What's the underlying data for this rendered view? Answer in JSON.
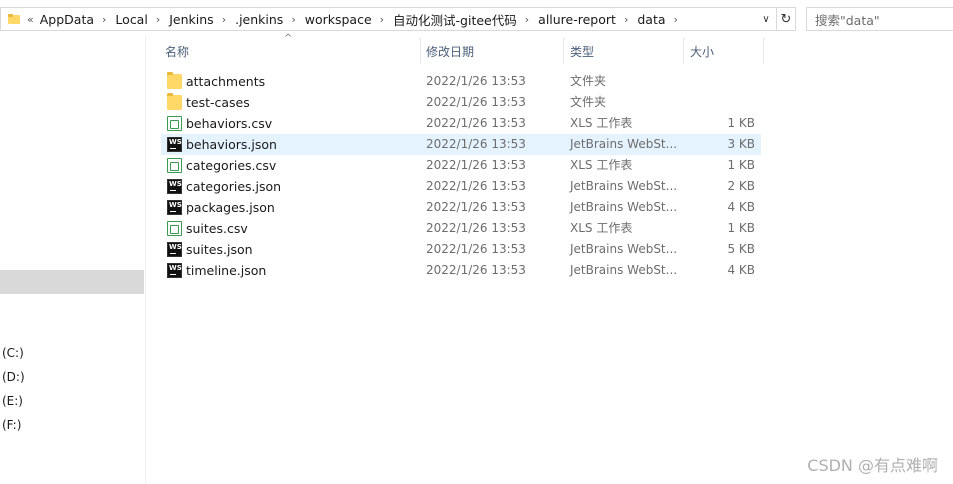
{
  "address_bar": {
    "lead_glyph": "«",
    "crumbs": [
      "AppData",
      "Local",
      "Jenkins",
      ".jenkins",
      "workspace",
      "自动化测试-gitee代码",
      "allure-report",
      "data"
    ],
    "chevron": "›",
    "dropdown_glyph": "∨",
    "refresh_glyph": "↻"
  },
  "search": {
    "placeholder": "搜索\"data\""
  },
  "columns": {
    "name": "名称",
    "date": "修改日期",
    "type": "类型",
    "size": "大小",
    "sort_glyph": "^"
  },
  "files": [
    {
      "name": "attachments",
      "date": "2022/1/26 13:53",
      "type": "文件夹",
      "size": "",
      "icon": "folder-icon"
    },
    {
      "name": "test-cases",
      "date": "2022/1/26 13:53",
      "type": "文件夹",
      "size": "",
      "icon": "folder-icon"
    },
    {
      "name": "behaviors.csv",
      "date": "2022/1/26 13:53",
      "type": "XLS 工作表",
      "size": "1 KB",
      "icon": "csv-file-icon"
    },
    {
      "name": "behaviors.json",
      "date": "2022/1/26 13:53",
      "type": "JetBrains WebSt...",
      "size": "3 KB",
      "icon": "webstorm-json-icon",
      "highlighted": true
    },
    {
      "name": "categories.csv",
      "date": "2022/1/26 13:53",
      "type": "XLS 工作表",
      "size": "1 KB",
      "icon": "csv-file-icon"
    },
    {
      "name": "categories.json",
      "date": "2022/1/26 13:53",
      "type": "JetBrains WebSt...",
      "size": "2 KB",
      "icon": "webstorm-json-icon"
    },
    {
      "name": "packages.json",
      "date": "2022/1/26 13:53",
      "type": "JetBrains WebSt...",
      "size": "4 KB",
      "icon": "webstorm-json-icon"
    },
    {
      "name": "suites.csv",
      "date": "2022/1/26 13:53",
      "type": "XLS 工作表",
      "size": "1 KB",
      "icon": "csv-file-icon"
    },
    {
      "name": "suites.json",
      "date": "2022/1/26 13:53",
      "type": "JetBrains WebSt...",
      "size": "5 KB",
      "icon": "webstorm-json-icon"
    },
    {
      "name": "timeline.json",
      "date": "2022/1/26 13:53",
      "type": "JetBrains WebSt...",
      "size": "4 KB",
      "icon": "webstorm-json-icon"
    }
  ],
  "nav": {
    "drives": [
      "(C:)",
      "(D:)",
      "(E:)",
      "(F:)"
    ]
  },
  "watermark": "CSDN @有点难啊",
  "colors": {
    "selection": "#d9d9d9",
    "row_highlight": "#e5f3ff",
    "header_text": "#4c607a",
    "folder": "#ffd868"
  }
}
